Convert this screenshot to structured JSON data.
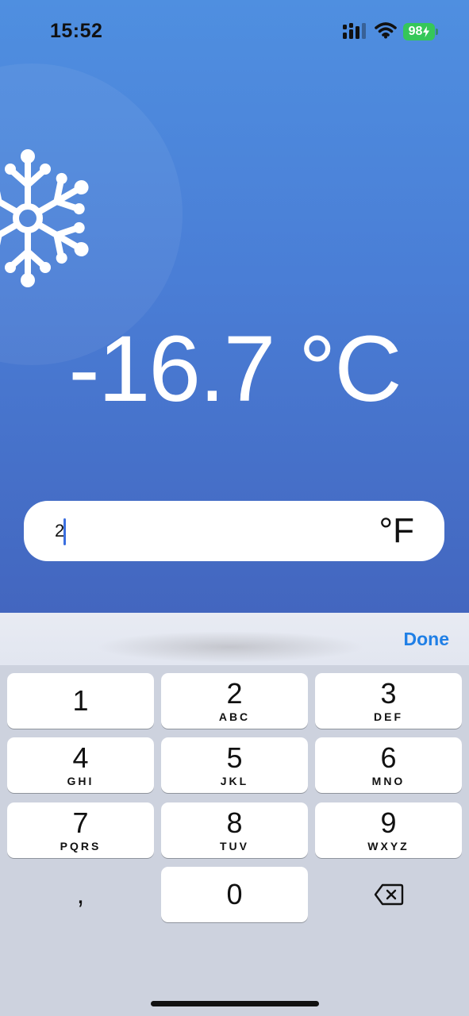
{
  "status_bar": {
    "time": "15:52",
    "battery": "98",
    "signal_icon": "signal-icon",
    "wifi_icon": "wifi-icon",
    "battery_icon": "battery-charging-icon",
    "battery_color": "#35c759"
  },
  "background": {
    "icon": "snowflake-icon",
    "gradient_top": "#4f8fe0",
    "gradient_bottom": "#4366bf"
  },
  "result": {
    "value": "-16.7 °C"
  },
  "input": {
    "value": "2",
    "unit": "°F"
  },
  "toolbar": {
    "done_label": "Done",
    "accent": "#1f7fe6"
  },
  "keypad": {
    "keys": [
      {
        "digit": "1",
        "letters": ""
      },
      {
        "digit": "2",
        "letters": "ABC"
      },
      {
        "digit": "3",
        "letters": "DEF"
      },
      {
        "digit": "4",
        "letters": "GHI"
      },
      {
        "digit": "5",
        "letters": "JKL"
      },
      {
        "digit": "6",
        "letters": "MNO"
      },
      {
        "digit": "7",
        "letters": "PQRS"
      },
      {
        "digit": "8",
        "letters": "TUV"
      },
      {
        "digit": "9",
        "letters": "WXYZ"
      }
    ],
    "comma": ",",
    "zero": "0",
    "delete_icon": "backspace-icon"
  }
}
